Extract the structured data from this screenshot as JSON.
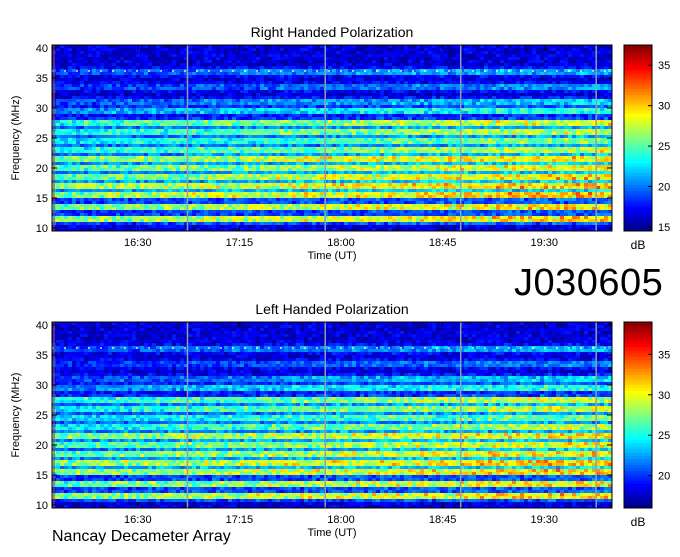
{
  "figure": {
    "id_label": "J030605",
    "footer": "Nancay Decameter Array"
  },
  "chart_data": [
    {
      "type": "heatmap",
      "title": "Right Handed Polarization",
      "xlabel": "Time (UT)",
      "ylabel": "Frequency (MHz)",
      "x_ticks": [
        "16:30",
        "17:15",
        "18:00",
        "18:45",
        "19:30"
      ],
      "x_tick_minutes": [
        990,
        1035,
        1080,
        1125,
        1170
      ],
      "xlim_minutes": [
        952,
        1200
      ],
      "ylim": [
        9.5,
        40.5
      ],
      "y_ticks": [
        10,
        15,
        20,
        25,
        30,
        35,
        40
      ],
      "colorbar": {
        "label": "dB",
        "ticks": [
          15,
          20,
          25,
          30,
          35
        ],
        "range": [
          14.5,
          37.5
        ]
      },
      "vertical_markers_minutes": [
        1012,
        1073,
        1133,
        1193
      ],
      "bands": [
        {
          "freq": 11.5,
          "start": 30,
          "end": 37
        },
        {
          "freq": 13.5,
          "start": 29,
          "end": 36
        },
        {
          "freq": 15.5,
          "start": 30,
          "end": 37
        },
        {
          "freq": 17.0,
          "start": 31,
          "end": 37
        },
        {
          "freq": 18.5,
          "start": 29,
          "end": 36
        },
        {
          "freq": 20.0,
          "start": 28,
          "end": 35
        },
        {
          "freq": 21.5,
          "start": 30,
          "end": 36
        },
        {
          "freq": 23.0,
          "start": 26,
          "end": 33
        },
        {
          "freq": 24.5,
          "start": 25,
          "end": 31
        },
        {
          "freq": 26.0,
          "start": 26,
          "end": 33
        },
        {
          "freq": 27.5,
          "start": 27,
          "end": 34
        },
        {
          "freq": 29.5,
          "start": 22,
          "end": 28
        },
        {
          "freq": 31.0,
          "start": 20,
          "end": 25
        },
        {
          "freq": 33.5,
          "start": 19,
          "end": 23
        },
        {
          "freq": 36.0,
          "start": 20,
          "end": 24
        }
      ],
      "background_db": 16.5
    },
    {
      "type": "heatmap",
      "title": "Left Handed Polarization",
      "xlabel": "Time (UT)",
      "ylabel": "Frequency (MHz)",
      "x_ticks": [
        "16:30",
        "17:15",
        "18:00",
        "18:45",
        "19:30"
      ],
      "x_tick_minutes": [
        990,
        1035,
        1080,
        1125,
        1170
      ],
      "xlim_minutes": [
        952,
        1200
      ],
      "ylim": [
        9.5,
        40.5
      ],
      "y_ticks": [
        10,
        15,
        20,
        25,
        30,
        35,
        40
      ],
      "colorbar": {
        "label": "dB",
        "ticks": [
          20,
          25,
          30,
          35
        ],
        "range": [
          16,
          39
        ]
      },
      "vertical_markers_minutes": [
        1012,
        1073,
        1133,
        1193
      ],
      "bands": [
        {
          "freq": 11.5,
          "start": 31,
          "end": 38
        },
        {
          "freq": 13.5,
          "start": 30,
          "end": 37
        },
        {
          "freq": 15.5,
          "start": 31,
          "end": 38
        },
        {
          "freq": 17.0,
          "start": 32,
          "end": 38
        },
        {
          "freq": 18.5,
          "start": 30,
          "end": 37
        },
        {
          "freq": 20.0,
          "start": 29,
          "end": 36
        },
        {
          "freq": 21.5,
          "start": 31,
          "end": 37
        },
        {
          "freq": 23.0,
          "start": 27,
          "end": 34
        },
        {
          "freq": 24.5,
          "start": 26,
          "end": 32
        },
        {
          "freq": 26.0,
          "start": 27,
          "end": 35
        },
        {
          "freq": 27.5,
          "start": 28,
          "end": 35
        },
        {
          "freq": 29.5,
          "start": 23,
          "end": 30
        },
        {
          "freq": 31.0,
          "start": 21,
          "end": 27
        },
        {
          "freq": 33.5,
          "start": 20,
          "end": 24
        },
        {
          "freq": 36.0,
          "start": 21,
          "end": 25
        }
      ],
      "background_db": 18
    }
  ]
}
